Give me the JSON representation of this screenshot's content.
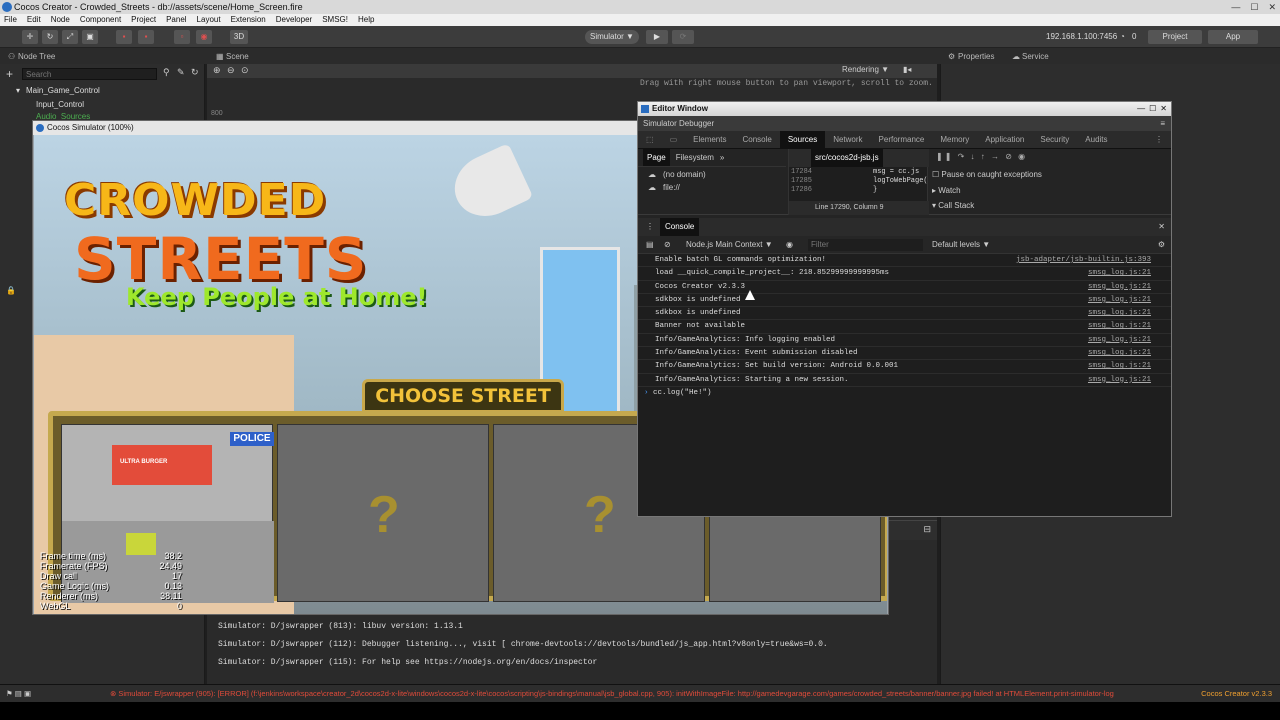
{
  "window": {
    "title": "Cocos Creator - Crowded_Streets - db://assets/scene/Home_Screen.fire",
    "controls": [
      "—",
      "☐",
      "✕"
    ]
  },
  "menu": [
    "File",
    "Edit",
    "Node",
    "Component",
    "Project",
    "Panel",
    "Layout",
    "Extension",
    "Developer",
    "SMSG!",
    "Help"
  ],
  "toolbar": {
    "mode_3d": "3D",
    "simulator": "Simulator ▼",
    "ip": "192.168.1.100:7456",
    "wifi_count": "0",
    "project_btn": "Project",
    "app_btn": "App"
  },
  "panels": {
    "node_tree": "Node Tree",
    "scene": "Scene",
    "properties": "Properties",
    "service": "Service"
  },
  "node_tree": {
    "search_placeholder": "Search",
    "nodes": [
      "Main_Game_Control",
      "Input_Control",
      "Audio_Sources"
    ]
  },
  "scene_bar": {
    "hint": "Drag with right mouse button to pan viewport, scroll to zoom.",
    "rendering": "Rendering ▼",
    "ruler_label": "800"
  },
  "simulator": {
    "title": "Cocos Simulator (100%)",
    "logo": {
      "line1": "CROWDED",
      "line2": "STREETS",
      "tagline": "Keep People at Home!"
    },
    "choose_street": "CHOOSE STREET",
    "police_sign": "POLICE",
    "shop_sign": "ULTRA BURGER",
    "locked_marks": [
      "?",
      "?"
    ],
    "stats": [
      {
        "label": "Frame time (ms)",
        "value": "38.2"
      },
      {
        "label": "Framerate (FPS)",
        "value": "24.49"
      },
      {
        "label": "Draw call",
        "value": "17"
      },
      {
        "label": "Game Logic (ms)",
        "value": "0.13"
      },
      {
        "label": "Renderer (ms)",
        "value": "38.11"
      },
      {
        "label": "WebGL",
        "value": "0"
      }
    ]
  },
  "editor_window": {
    "title": "Editor Window",
    "subtitle": "Simulator Debugger",
    "tabs": [
      "Elements",
      "Console",
      "Sources",
      "Network",
      "Performance",
      "Memory",
      "Application",
      "Security",
      "Audits"
    ],
    "active_tab": "Sources",
    "sources": {
      "nav_tabs": [
        "Page",
        "Filesystem",
        "»"
      ],
      "file_tab": "src/cocos2d-jsb.js",
      "tree": [
        "(no domain)",
        "file://"
      ],
      "code_lines": [
        {
          "n": "17284",
          "code": "msg = cc.js"
        },
        {
          "n": "17285",
          "code": "logToWebPage("
        },
        {
          "n": "17286",
          "code": "}"
        }
      ],
      "position": "Line 17290, Column 9",
      "position_link": "src/coco",
      "pause_caught": "Pause on caught exceptions",
      "watch": "Watch",
      "call_stack": "Call Stack"
    },
    "console": {
      "header": "Console",
      "context": "Node.js Main Context ▼",
      "filter_placeholder": "Filter",
      "levels": "Default levels ▼",
      "rows": [
        {
          "msg": "Enable batch GL commands optimization!",
          "src": "jsb-adapter/jsb-builtin.js:393"
        },
        {
          "msg": "load __quick_compile_project__: 218.85299999999995ms",
          "src": "smsg_log.js:21"
        },
        {
          "msg": "Cocos Creator v2.3.3",
          "src": "smsg_log.js:21"
        },
        {
          "msg": "sdkbox is undefined",
          "src": "smsg_log.js:21"
        },
        {
          "msg": "sdkbox is undefined",
          "src": "smsg_log.js:21"
        },
        {
          "msg": "Banner not available",
          "src": "smsg_log.js:21"
        },
        {
          "msg": "Info/GameAnalytics: Info logging enabled",
          "src": "smsg_log.js:21"
        },
        {
          "msg": "Info/GameAnalytics: Event submission disabled",
          "src": "smsg_log.js:21"
        },
        {
          "msg": "Info/GameAnalytics: Set build version: Android 0.0.001",
          "src": "smsg_log.js:21"
        },
        {
          "msg": "Info/GameAnalytics: Starting a new session.",
          "src": "smsg_log.js:21"
        }
      ],
      "input": "cc.log(\"He!\")"
    }
  },
  "terminal": [
    "Simulator: D/jswrapper (813): libuv version: 1.13.1",
    "Simulator: D/jswrapper (112): Debugger listening..., visit [ chrome-devtools://devtools/bundled/js_app.html?v8only=true&ws=0.0.",
    "Simulator: D/jswrapper (115): For help see https://nodejs.org/en/docs/inspector"
  ],
  "status": {
    "error": "Simulator: E/jswrapper (905): [ERROR] (f:\\jenkins\\workspace\\creator_2d\\cocos2d-x-lite\\windows\\cocos2d-x-lite\\cocos\\scripting\\js-bindings\\manual\\jsb_global.cpp, 905): initWithImageFile: http://gamedevgarage.com/games/crowded_streets/banner/banner.jpg failed! at HTMLElement.print-simulator-log",
    "version": "Cocos Creator v2.3.3"
  },
  "colors": {
    "accent": "#2a6dc0",
    "error": "#e04b3a",
    "version": "#f0a030",
    "logo_yellow": "#f7b718",
    "logo_orange": "#f06a1e",
    "logo_green": "#9ee82c"
  }
}
